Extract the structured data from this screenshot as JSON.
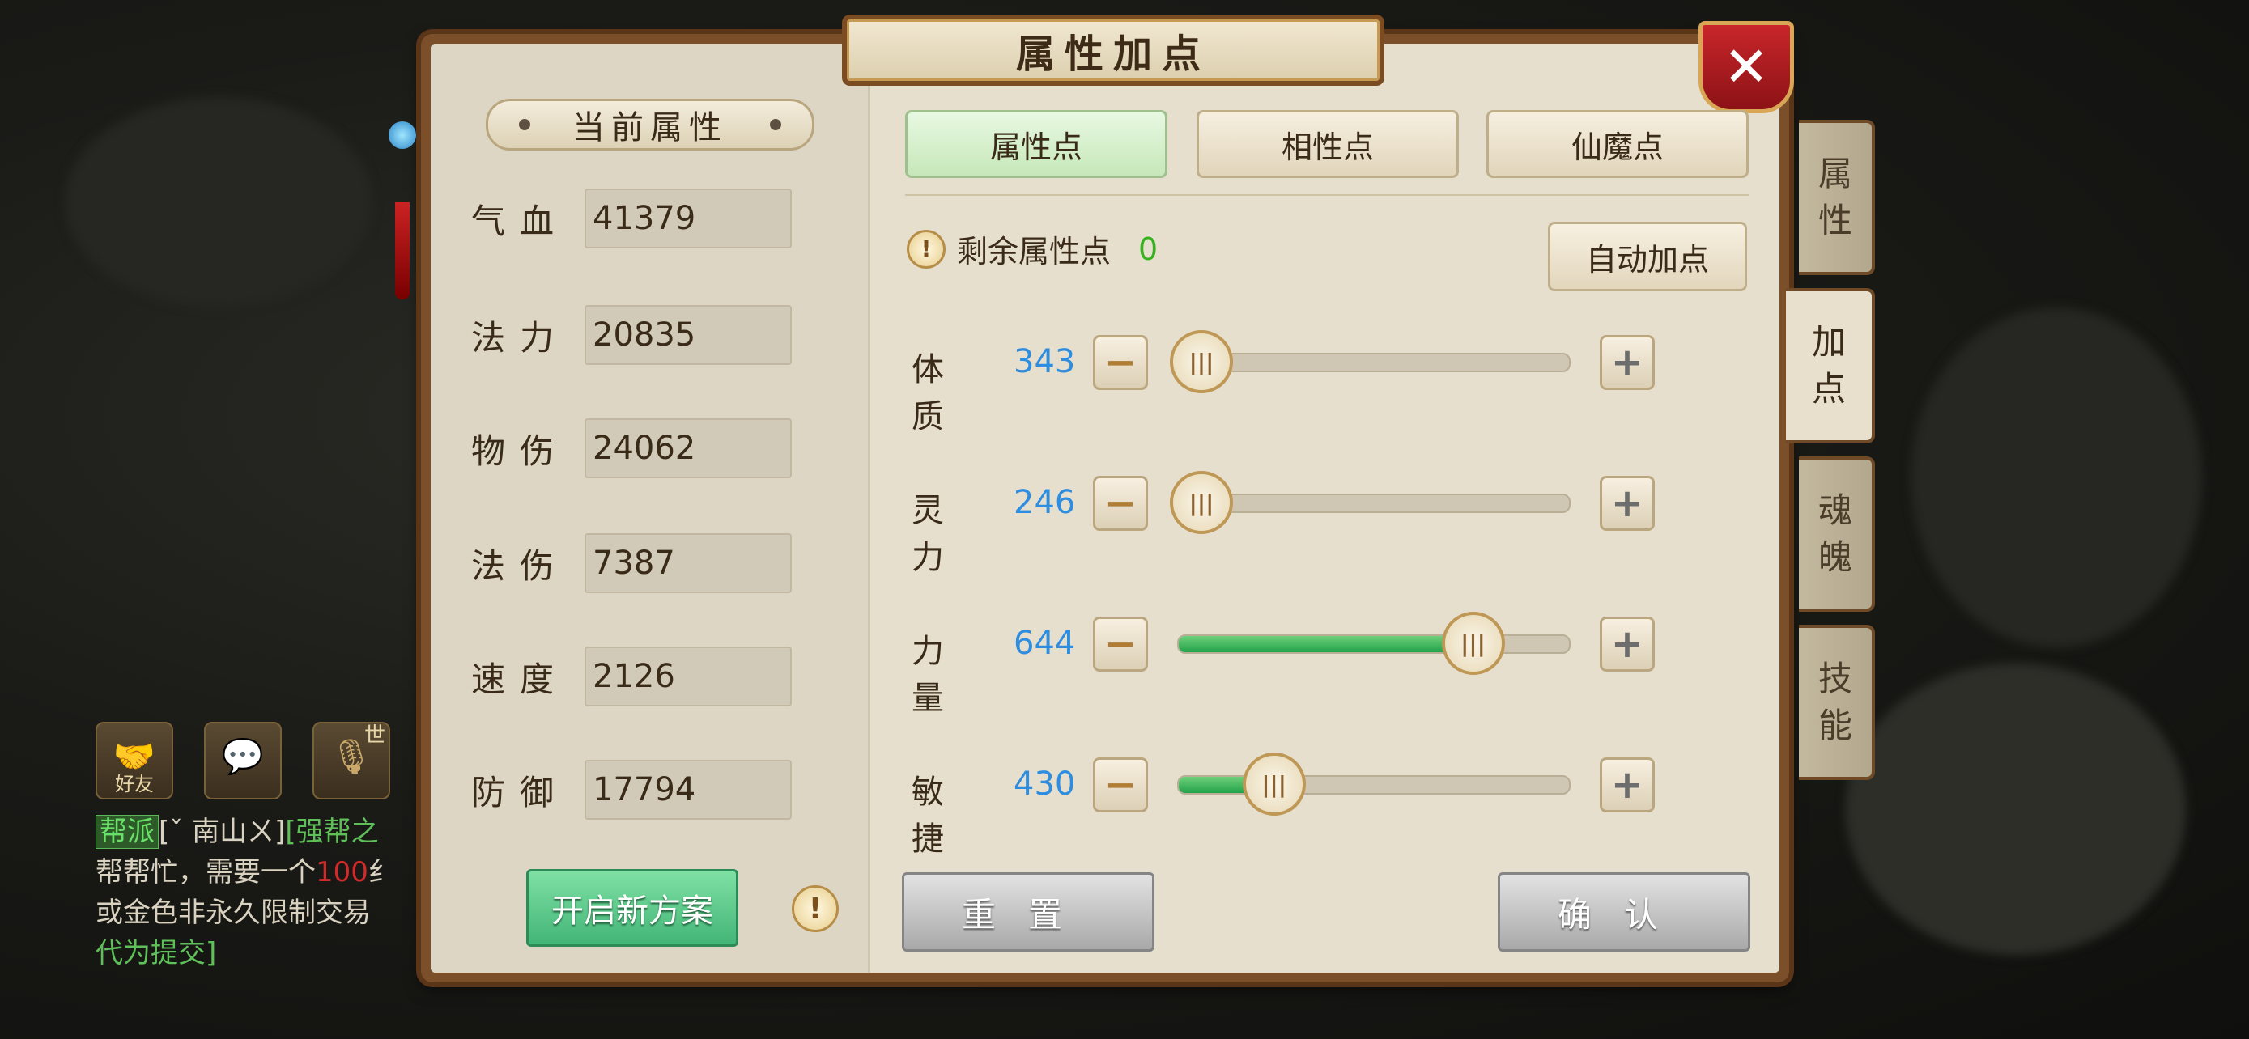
{
  "title": "属性加点",
  "current_attributes": {
    "header": "当前属性",
    "stats": [
      {
        "label": "气血",
        "value": "41379"
      },
      {
        "label": "法力",
        "value": "20835"
      },
      {
        "label": "物伤",
        "value": "24062"
      },
      {
        "label": "法伤",
        "value": "7387"
      },
      {
        "label": "速度",
        "value": "2126"
      },
      {
        "label": "防御",
        "value": "17794"
      }
    ],
    "new_plan_label": "开启新方案"
  },
  "tabs": [
    "属性点",
    "相性点",
    "仙魔点"
  ],
  "active_tab": "属性点",
  "remaining": {
    "label": "剩余属性点",
    "value": "0"
  },
  "auto_label": "自动加点",
  "sliders": [
    {
      "label": "体质",
      "value": "343",
      "fill": 0.0
    },
    {
      "label": "灵力",
      "value": "246",
      "fill": 0.0
    },
    {
      "label": "力量",
      "value": "644",
      "fill": 0.75
    },
    {
      "label": "敏捷",
      "value": "430",
      "fill": 0.24
    }
  ],
  "reset_label": "重置",
  "confirm_label": "确认",
  "side_tabs": [
    "属性",
    "加点",
    "魂魄",
    "技能"
  ],
  "active_side_tab": "加点",
  "chat": {
    "buttons": [
      {
        "label": "好友",
        "icon": "handshake-icon"
      },
      {
        "label": "",
        "icon": "chat-bubble-icon"
      },
      {
        "label": "世",
        "icon": "microphone-icon"
      }
    ],
    "channel": "帮派",
    "sender": "[ˇ 南山ㄨ]",
    "group_fragment": "[强帮之",
    "line2_prefix": "帮帮忙，需要一个",
    "line2_number": "100",
    "line2_suffix": "纟",
    "line3": "或金色非永久限制交易",
    "line4": "代为提交]"
  },
  "colors": {
    "stat_value_blue": "#2d8de0",
    "remaining_green": "#36b21f",
    "active_tab_green": "#c6e8b9",
    "slider_fill_green": "#22a24a",
    "close_red": "#c8262a"
  }
}
